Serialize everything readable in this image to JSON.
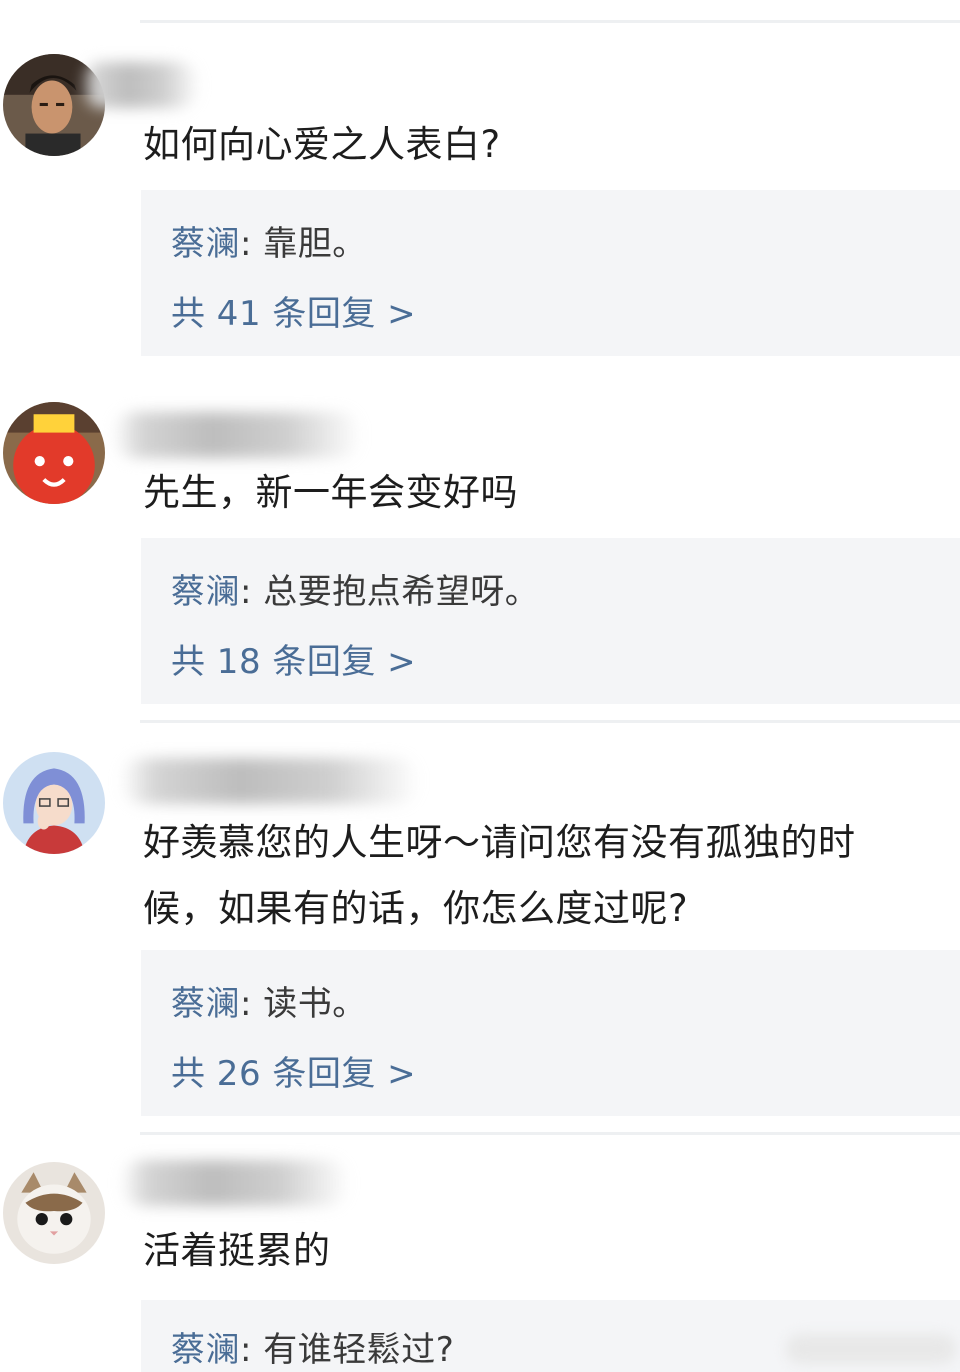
{
  "comments": [
    {
      "text": "如何向心爱之人表白?",
      "reply": {
        "author": "蔡澜",
        "sep": ": ",
        "text": "靠胆。"
      },
      "count_label": "共 41 条回复 >"
    },
    {
      "text": "先生，新一年会变好吗",
      "reply": {
        "author": "蔡澜",
        "sep": ": ",
        "text": "总要抱点希望呀。"
      },
      "count_label": "共 18 条回复 >"
    },
    {
      "text_line1": "好羡慕您的人生呀～请问您有没有孤独的时",
      "text_line2": "候，如果有的话，你怎么度过呢?",
      "reply": {
        "author": "蔡澜",
        "sep": ": ",
        "text": "读书。"
      },
      "count_label": "共 26 条回复 >"
    },
    {
      "text": "活着挺累的",
      "reply": {
        "author": "蔡澜",
        "sep": ": ",
        "text": "有谁轻鬆过?"
      }
    }
  ],
  "colors": {
    "reply_bg": "#f4f5f7",
    "link_blue": "#4a6d96",
    "text": "#1d1d1d"
  }
}
